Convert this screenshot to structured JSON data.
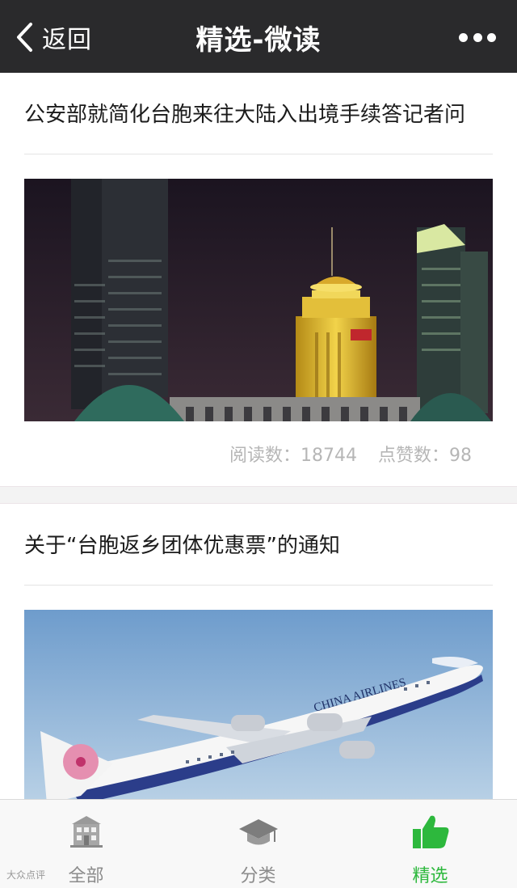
{
  "header": {
    "back_label": "返回",
    "title": "精选-微读",
    "back_icon": "chevron-left-icon",
    "more_icon": "more-dots-icon"
  },
  "articles": [
    {
      "title": "公安部就简化台胞来往大陆入出境手续答记者问",
      "image": "city-night-skyline-image",
      "stats": {
        "reads_label": "阅读数：18744",
        "likes_label": "点赞数：98"
      }
    },
    {
      "title": "关于“台胞返乡团体优惠票”的通知",
      "image": "airplane-takeoff-image",
      "airline_text": "CHINA AIRLINES"
    }
  ],
  "tabbar": {
    "tabs": [
      {
        "label": "全部",
        "icon": "building-icon",
        "active": false
      },
      {
        "label": "分类",
        "icon": "graduation-cap-icon",
        "active": false
      },
      {
        "label": "精选",
        "icon": "thumbs-up-icon",
        "active": true
      }
    ]
  },
  "watermark": "大众点评",
  "colors": {
    "topbar": "#2a2a2c",
    "accent_green": "#2db83d",
    "stats_gray": "#b6b6b6"
  }
}
